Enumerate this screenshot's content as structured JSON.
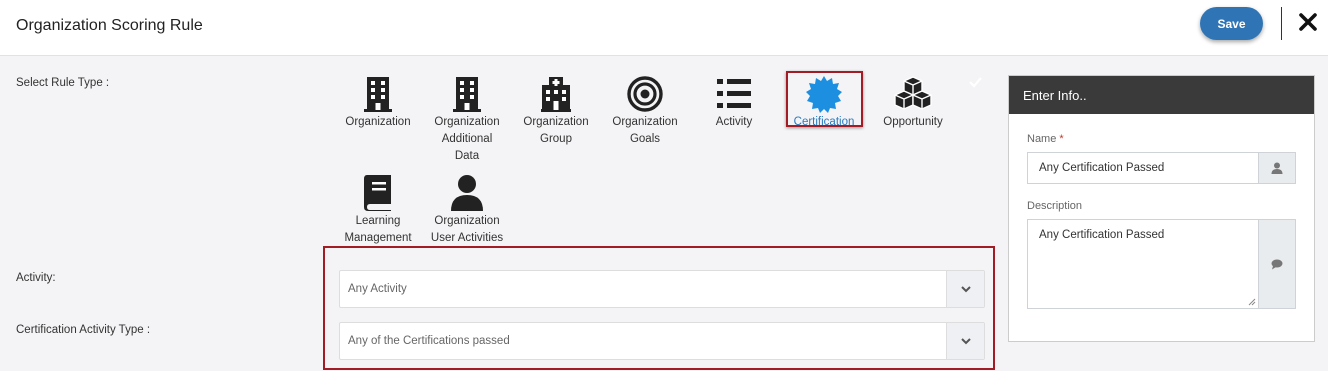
{
  "header": {
    "title": "Organization Scoring Rule",
    "save_label": "Save",
    "close_icon": "close-icon"
  },
  "labels": {
    "rule_type": "Select Rule Type :",
    "activity": "Activity:",
    "cert_activity_type": "Certification Activity Type :"
  },
  "rule_types": [
    {
      "label_lines": [
        "Organization"
      ],
      "icon": "building-icon"
    },
    {
      "label_lines": [
        "Organization",
        "Additional",
        "Data"
      ],
      "icon": "building-icon"
    },
    {
      "label_lines": [
        "Organization",
        "Group"
      ],
      "icon": "hospital-icon"
    },
    {
      "label_lines": [
        "Organization",
        "Goals"
      ],
      "icon": "target-icon"
    },
    {
      "label_lines": [
        "Activity"
      ],
      "icon": "list-icon"
    },
    {
      "label_lines": [
        "Certification"
      ],
      "icon": "certificate-icon",
      "selected": true
    },
    {
      "label_lines": [
        "Opportunity"
      ],
      "icon": "cubes-icon"
    },
    {
      "label_lines": [
        "Learning",
        "Management"
      ],
      "icon": "book-icon"
    },
    {
      "label_lines": [
        "Organization",
        "User Activities"
      ],
      "icon": "user-icon"
    }
  ],
  "selects": {
    "activity": {
      "value": "Any Activity"
    },
    "cert_activity_type": {
      "value": "Any of the Certifications passed"
    }
  },
  "panel": {
    "title": "Enter Info..",
    "name_label": "Name",
    "required_mark": "*",
    "name_value": "Any Certification Passed",
    "description_label": "Description",
    "description_value": "Any Certification Passed"
  },
  "colors": {
    "accent": "#2f75b5",
    "selected_text": "#2a7ac0",
    "highlight_border": "#a11c24",
    "panel_header": "#3a3a3a"
  }
}
